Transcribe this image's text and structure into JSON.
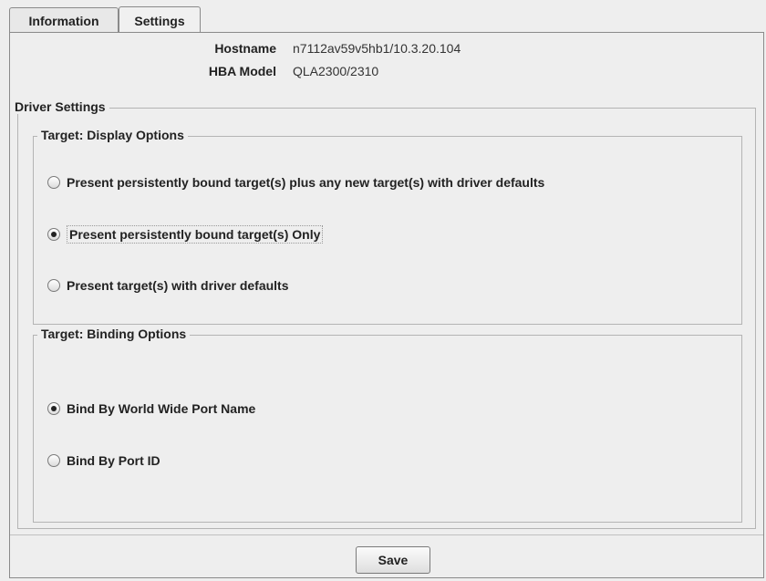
{
  "tabs": {
    "information": "Information",
    "settings": "Settings"
  },
  "info": {
    "hostname_label": "Hostname",
    "hostname_value": "n7112av59v5hb1/10.3.20.104",
    "hba_model_label": "HBA Model",
    "hba_model_value": "QLA2300/2310"
  },
  "driver_settings": {
    "title": "Driver Settings",
    "display_options": {
      "title": "Target: Display Options",
      "options": [
        {
          "label": "Present persistently bound target(s) plus any new target(s) with driver defaults",
          "checked": false
        },
        {
          "label": "Present persistently bound target(s) Only",
          "checked": true
        },
        {
          "label": "Present target(s) with driver defaults",
          "checked": false
        }
      ]
    },
    "binding_options": {
      "title": "Target: Binding Options",
      "options": [
        {
          "label": "Bind By World Wide Port Name",
          "checked": true
        },
        {
          "label": "Bind By Port ID",
          "checked": false
        }
      ]
    }
  },
  "actions": {
    "save": "Save"
  }
}
